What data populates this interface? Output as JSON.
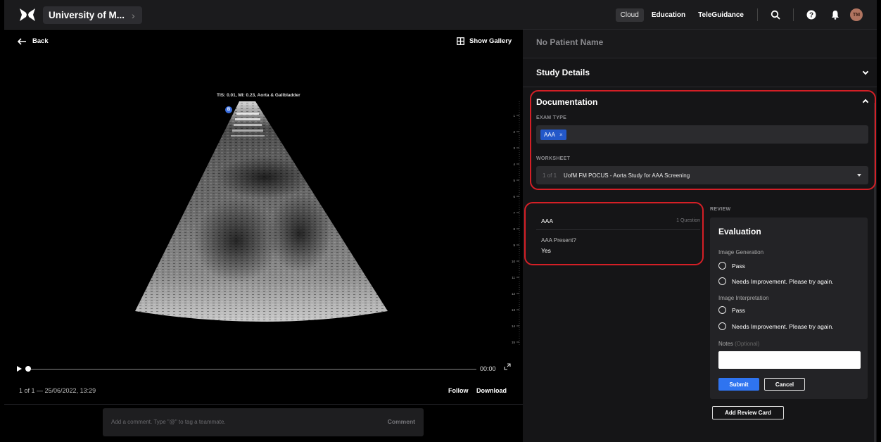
{
  "topbar": {
    "org_name": "University of M...",
    "nav": [
      "Cloud",
      "Education",
      "TeleGuidance"
    ],
    "avatar_initials": "TM",
    "brand_color": "#ffffff"
  },
  "viewer": {
    "back_label": "Back",
    "gallery_label": "Show Gallery",
    "scan_label": "TIS: 0.01, MI: 0.23, Aorta & Gallbladder",
    "mode_badge": "B",
    "depth_ticks": [
      "1",
      "2",
      "3",
      "4",
      "5",
      "6",
      "7",
      "8",
      "9",
      "10",
      "11",
      "12",
      "13",
      "14",
      "15"
    ],
    "time": "00:00",
    "progress": 0,
    "meta": "1 of 1 — 25/06/2022, 13:29",
    "follow_label": "Follow",
    "download_label": "Download",
    "comment_placeholder": "Add a comment. Type \"@\" to tag a teammate.",
    "comment_button": "Comment"
  },
  "panel": {
    "patient_name": "No Patient Name",
    "study_details": "Study Details",
    "documentation": {
      "title": "Documentation",
      "exam_type_label": "EXAM TYPE",
      "exam_type_chip": "AAA",
      "chip_remove": "×",
      "worksheet_label": "WORKSHEET",
      "worksheet_count": "1 of 1",
      "worksheet_name": "UofM FM POCUS - Aorta Study for AAA Screening"
    },
    "question_card": {
      "name": "AAA",
      "count": "1 Question",
      "question": "AAA Present?",
      "answer": "Yes"
    },
    "review": {
      "label": "REVIEW",
      "title": "Evaluation",
      "image_generation": "Image Generation",
      "image_interpretation": "Image Interpretation",
      "pass": "Pass",
      "needs_improvement": "Needs Improvement. Please try again.",
      "notes_label": "Notes",
      "notes_optional": "(Optional)",
      "submit": "Submit",
      "cancel": "Cancel",
      "add_review_card": "Add Review Card"
    }
  },
  "colors": {
    "accent": "#2f74f0",
    "chip": "#2358c9",
    "highlight": "#d41f26"
  }
}
